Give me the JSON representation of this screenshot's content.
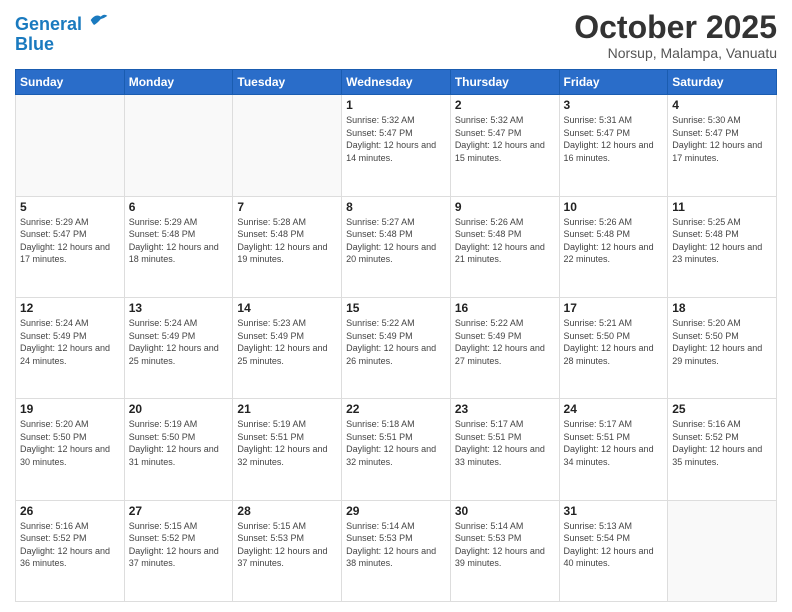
{
  "header": {
    "logo_line1": "General",
    "logo_line2": "Blue",
    "month": "October 2025",
    "location": "Norsup, Malampa, Vanuatu"
  },
  "days_of_week": [
    "Sunday",
    "Monday",
    "Tuesday",
    "Wednesday",
    "Thursday",
    "Friday",
    "Saturday"
  ],
  "weeks": [
    [
      {
        "day": "",
        "info": ""
      },
      {
        "day": "",
        "info": ""
      },
      {
        "day": "",
        "info": ""
      },
      {
        "day": "1",
        "info": "Sunrise: 5:32 AM\nSunset: 5:47 PM\nDaylight: 12 hours and 14 minutes."
      },
      {
        "day": "2",
        "info": "Sunrise: 5:32 AM\nSunset: 5:47 PM\nDaylight: 12 hours and 15 minutes."
      },
      {
        "day": "3",
        "info": "Sunrise: 5:31 AM\nSunset: 5:47 PM\nDaylight: 12 hours and 16 minutes."
      },
      {
        "day": "4",
        "info": "Sunrise: 5:30 AM\nSunset: 5:47 PM\nDaylight: 12 hours and 17 minutes."
      }
    ],
    [
      {
        "day": "5",
        "info": "Sunrise: 5:29 AM\nSunset: 5:47 PM\nDaylight: 12 hours and 17 minutes."
      },
      {
        "day": "6",
        "info": "Sunrise: 5:29 AM\nSunset: 5:48 PM\nDaylight: 12 hours and 18 minutes."
      },
      {
        "day": "7",
        "info": "Sunrise: 5:28 AM\nSunset: 5:48 PM\nDaylight: 12 hours and 19 minutes."
      },
      {
        "day": "8",
        "info": "Sunrise: 5:27 AM\nSunset: 5:48 PM\nDaylight: 12 hours and 20 minutes."
      },
      {
        "day": "9",
        "info": "Sunrise: 5:26 AM\nSunset: 5:48 PM\nDaylight: 12 hours and 21 minutes."
      },
      {
        "day": "10",
        "info": "Sunrise: 5:26 AM\nSunset: 5:48 PM\nDaylight: 12 hours and 22 minutes."
      },
      {
        "day": "11",
        "info": "Sunrise: 5:25 AM\nSunset: 5:48 PM\nDaylight: 12 hours and 23 minutes."
      }
    ],
    [
      {
        "day": "12",
        "info": "Sunrise: 5:24 AM\nSunset: 5:49 PM\nDaylight: 12 hours and 24 minutes."
      },
      {
        "day": "13",
        "info": "Sunrise: 5:24 AM\nSunset: 5:49 PM\nDaylight: 12 hours and 25 minutes."
      },
      {
        "day": "14",
        "info": "Sunrise: 5:23 AM\nSunset: 5:49 PM\nDaylight: 12 hours and 25 minutes."
      },
      {
        "day": "15",
        "info": "Sunrise: 5:22 AM\nSunset: 5:49 PM\nDaylight: 12 hours and 26 minutes."
      },
      {
        "day": "16",
        "info": "Sunrise: 5:22 AM\nSunset: 5:49 PM\nDaylight: 12 hours and 27 minutes."
      },
      {
        "day": "17",
        "info": "Sunrise: 5:21 AM\nSunset: 5:50 PM\nDaylight: 12 hours and 28 minutes."
      },
      {
        "day": "18",
        "info": "Sunrise: 5:20 AM\nSunset: 5:50 PM\nDaylight: 12 hours and 29 minutes."
      }
    ],
    [
      {
        "day": "19",
        "info": "Sunrise: 5:20 AM\nSunset: 5:50 PM\nDaylight: 12 hours and 30 minutes."
      },
      {
        "day": "20",
        "info": "Sunrise: 5:19 AM\nSunset: 5:50 PM\nDaylight: 12 hours and 31 minutes."
      },
      {
        "day": "21",
        "info": "Sunrise: 5:19 AM\nSunset: 5:51 PM\nDaylight: 12 hours and 32 minutes."
      },
      {
        "day": "22",
        "info": "Sunrise: 5:18 AM\nSunset: 5:51 PM\nDaylight: 12 hours and 32 minutes."
      },
      {
        "day": "23",
        "info": "Sunrise: 5:17 AM\nSunset: 5:51 PM\nDaylight: 12 hours and 33 minutes."
      },
      {
        "day": "24",
        "info": "Sunrise: 5:17 AM\nSunset: 5:51 PM\nDaylight: 12 hours and 34 minutes."
      },
      {
        "day": "25",
        "info": "Sunrise: 5:16 AM\nSunset: 5:52 PM\nDaylight: 12 hours and 35 minutes."
      }
    ],
    [
      {
        "day": "26",
        "info": "Sunrise: 5:16 AM\nSunset: 5:52 PM\nDaylight: 12 hours and 36 minutes."
      },
      {
        "day": "27",
        "info": "Sunrise: 5:15 AM\nSunset: 5:52 PM\nDaylight: 12 hours and 37 minutes."
      },
      {
        "day": "28",
        "info": "Sunrise: 5:15 AM\nSunset: 5:53 PM\nDaylight: 12 hours and 37 minutes."
      },
      {
        "day": "29",
        "info": "Sunrise: 5:14 AM\nSunset: 5:53 PM\nDaylight: 12 hours and 38 minutes."
      },
      {
        "day": "30",
        "info": "Sunrise: 5:14 AM\nSunset: 5:53 PM\nDaylight: 12 hours and 39 minutes."
      },
      {
        "day": "31",
        "info": "Sunrise: 5:13 AM\nSunset: 5:54 PM\nDaylight: 12 hours and 40 minutes."
      },
      {
        "day": "",
        "info": ""
      }
    ]
  ]
}
